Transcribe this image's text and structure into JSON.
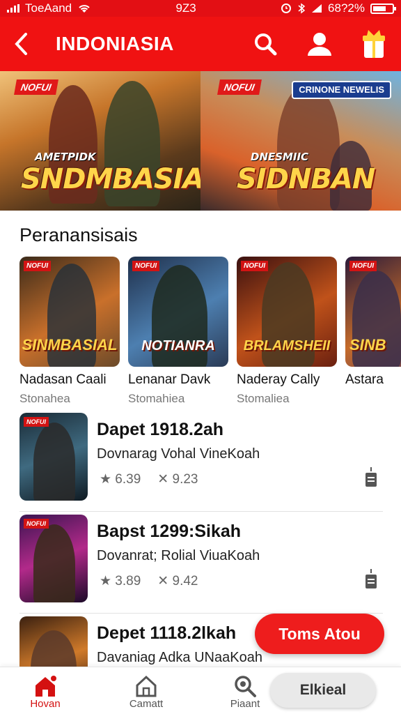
{
  "status_bar": {
    "carrier": "ToeAand",
    "time": "9Z3",
    "battery": "68?2%"
  },
  "app_bar": {
    "title": "INDONIASIA"
  },
  "hero": {
    "left": {
      "tag": "NOFUI",
      "subtitle": "AMETPIDK",
      "title": "SNDMBASIAL"
    },
    "right": {
      "tag": "NOFUI",
      "news": "CRINONE NEWELIS",
      "subtitle": "DNESMIIC",
      "title": "SIDNBAN"
    }
  },
  "section": {
    "title": "Peranansisais"
  },
  "carousel": [
    {
      "tag": "NOFUI",
      "logo": "SINMBASIAL",
      "title": "Nadasan Caali",
      "subtitle": "Stonahea",
      "colors": [
        "#3a2a1a",
        "#c9702b",
        "#6b4a2a"
      ]
    },
    {
      "tag": "NOFUI",
      "logo": "NOTIANRA",
      "title": "Lenanar Davk",
      "subtitle": "Stomahiea",
      "colors": [
        "#1f2f4a",
        "#4d7fb0",
        "#2a3a55"
      ]
    },
    {
      "tag": "NOFUI",
      "logo": "BRLAMSHEII",
      "title": "Naderay Cally",
      "subtitle": "Stomaliea",
      "colors": [
        "#3a1010",
        "#c0521a",
        "#6a2010"
      ]
    },
    {
      "tag": "NOFUI",
      "logo": "SINB",
      "title": "Astara",
      "subtitle": "",
      "colors": [
        "#2a1a3a",
        "#c56b2a",
        "#5a3a5a"
      ]
    }
  ],
  "list": [
    {
      "title": "Dapet 1918.2ah",
      "subtitle": "Dovnarag Vohal VineKoah",
      "rating": "★ 6.39",
      "count": "✕ 9.23",
      "thumb_colors": [
        "#1a2a35",
        "#3f6a80",
        "#0f1a22"
      ]
    },
    {
      "title": "Bapst 1299:Sikah",
      "subtitle": "Dovanrat; Rolial ViuaKoah",
      "rating": "★ 3.89",
      "count": "✕ 9.42",
      "thumb_colors": [
        "#3a1450",
        "#b22a8a",
        "#1c0a28"
      ]
    },
    {
      "title": "Depet 1118.2lkah",
      "subtitle": "Davaniag Adka UNaaKoah",
      "rating": "",
      "count": "",
      "thumb_colors": [
        "#3a2010",
        "#d07a2a",
        "#2a1510"
      ]
    }
  ],
  "fab": {
    "label": "Toms Atou"
  },
  "bottom_nav": {
    "items": [
      {
        "label": "Hovan"
      },
      {
        "label": "Camatt"
      },
      {
        "label": "Piaant"
      }
    ],
    "pill_label": "Elkieal"
  }
}
